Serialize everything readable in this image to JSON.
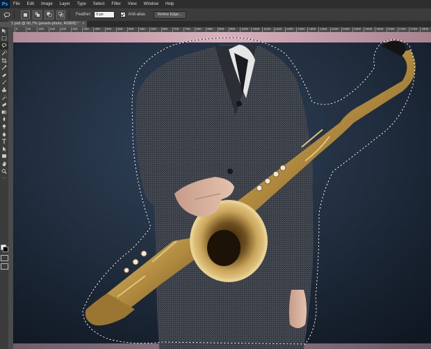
{
  "app": {
    "logo": "Ps"
  },
  "menu": [
    "File",
    "Edit",
    "Image",
    "Layer",
    "Type",
    "Select",
    "Filter",
    "View",
    "Window",
    "Help"
  ],
  "options": {
    "feather_label": "Feather:",
    "feather_value": "0 px",
    "antialias_label": "Anti-alias",
    "antialias_checked": true,
    "refine_edge_label": "Refine Edge..."
  },
  "document": {
    "tab_title": "1.psd @ 66,7% (pexels-photo, RGB/8) *",
    "close_symbol": "×"
  },
  "ruler": {
    "ticks": [
      "0",
      "50",
      "100",
      "150",
      "200",
      "250",
      "300",
      "350",
      "400",
      "450",
      "500",
      "550",
      "600",
      "650",
      "700",
      "750",
      "800",
      "850",
      "900",
      "950",
      "1000",
      "1050",
      "1100",
      "1150",
      "1200",
      "1250",
      "1300",
      "1350",
      "1400",
      "1450",
      "1500",
      "1550",
      "1600",
      "1650",
      "1700",
      "1750",
      "1800",
      "1850"
    ]
  },
  "tools": [
    "move-tool",
    "marquee-tool",
    "lasso-tool",
    "quick-selection-tool",
    "crop-tool",
    "eyedropper-tool",
    "healing-brush-tool",
    "brush-tool",
    "clone-stamp-tool",
    "history-brush-tool",
    "eraser-tool",
    "gradient-tool",
    "blur-tool",
    "dodge-tool",
    "pen-tool",
    "type-tool",
    "path-selection-tool",
    "shape-tool",
    "hand-tool",
    "zoom-tool"
  ],
  "colors": {
    "foreground": "#ffffff",
    "background": "#000000",
    "backdrop": "#1f2c3c",
    "saxophone_brass": "#b08a3e"
  }
}
